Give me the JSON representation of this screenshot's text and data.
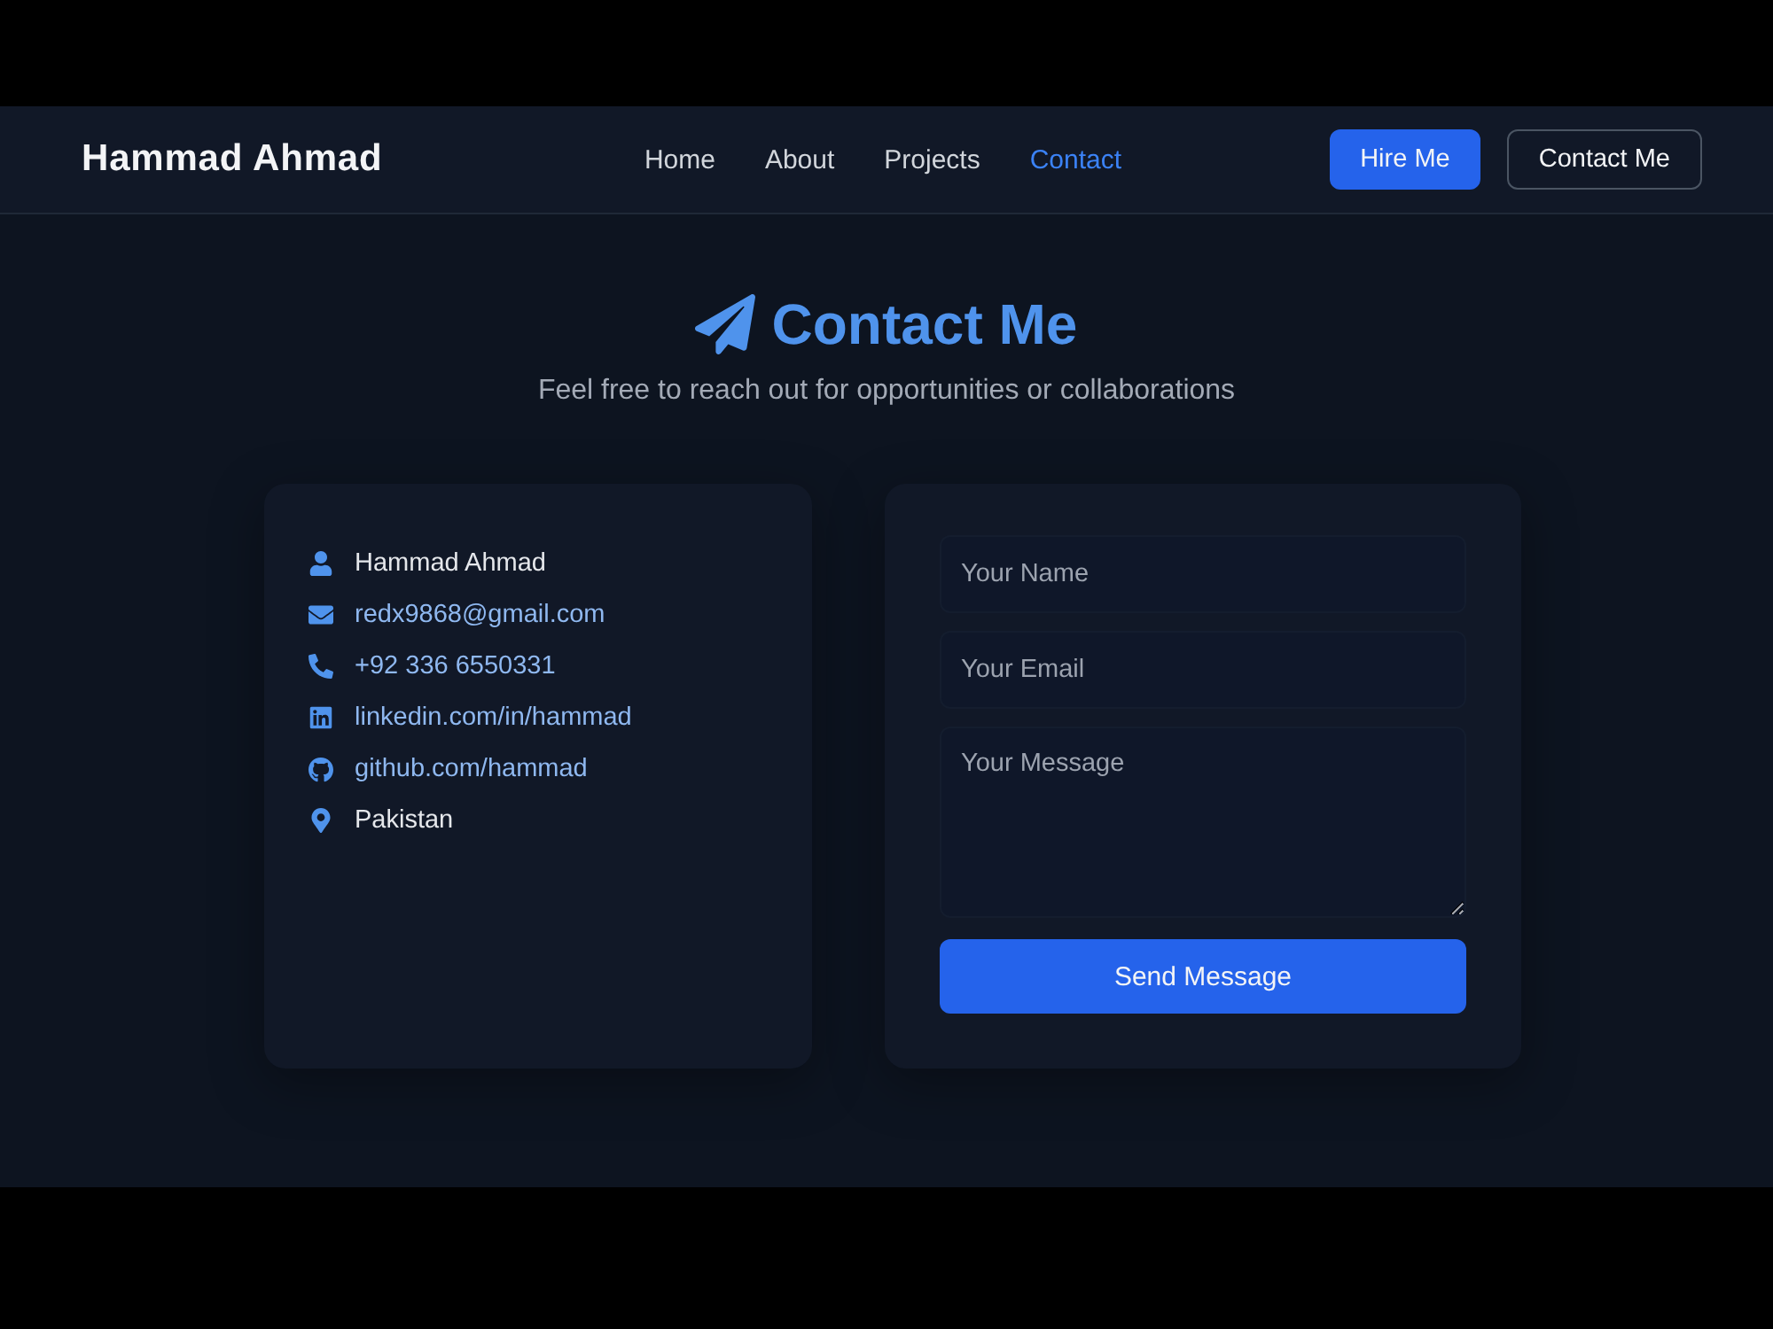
{
  "nav": {
    "brand": "Hammad Ahmad",
    "links": [
      {
        "label": "Home",
        "selected": false
      },
      {
        "label": "About",
        "selected": false
      },
      {
        "label": "Projects",
        "selected": false
      },
      {
        "label": "Contact",
        "selected": true
      }
    ],
    "buttons": [
      {
        "label": "Hire Me",
        "kind": "primary"
      },
      {
        "label": "Contact Me",
        "kind": "outline"
      }
    ]
  },
  "header": {
    "title": "Contact Me",
    "subtitle": "Feel free to reach out for opportunities or collaborations"
  },
  "contact_info": [
    {
      "kind": "person",
      "text": "Hammad Ahmad",
      "link": false
    },
    {
      "kind": "email",
      "text": "redx9868@gmail.com",
      "link": true
    },
    {
      "kind": "phone",
      "text": "+92 336 6550331",
      "link": true
    },
    {
      "kind": "linkedin",
      "text": "linkedin.com/in/hammad",
      "link": true
    },
    {
      "kind": "github",
      "text": "github.com/hammad",
      "link": true
    },
    {
      "kind": "location",
      "text": "Pakistan",
      "link": false
    }
  ],
  "form": {
    "fields": [
      {
        "kind": "input",
        "placeholder": "Your Name"
      },
      {
        "kind": "input",
        "placeholder": "Your Email"
      },
      {
        "kind": "textarea",
        "placeholder": "Your Message"
      }
    ],
    "submit": "Send Message"
  }
}
